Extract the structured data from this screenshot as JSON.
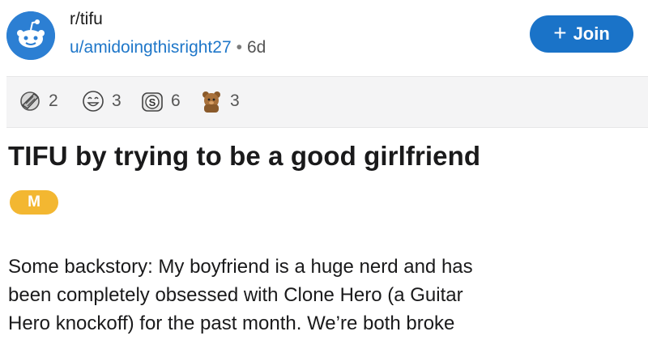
{
  "post": {
    "subreddit": "r/tifu",
    "author": "u/amidoingthisright27",
    "separator": "•",
    "age": "6d",
    "join_label": "Join",
    "join_icon": "plus-icon",
    "title": "TIFU by trying to be a good girlfriend",
    "flair": "M",
    "body_lines": [
      "Some backstory: My boyfriend is a huge nerd and has",
      "been completely obsessed with Clone Hero (a Guitar",
      "Hero knockoff) for the past month. We’re both broke"
    ]
  },
  "awards": [
    {
      "icon": "facepalm-award-icon",
      "count": "2"
    },
    {
      "icon": "laughing-face-award-icon",
      "count": "3"
    },
    {
      "icon": "silver-award-icon",
      "count": "6"
    },
    {
      "icon": "bear-award-icon",
      "count": "3"
    }
  ],
  "colors": {
    "join_button": "#1a73c8",
    "link": "#1f77c9",
    "flair": "#f3b731",
    "awards_bar": "#f4f4f5"
  }
}
